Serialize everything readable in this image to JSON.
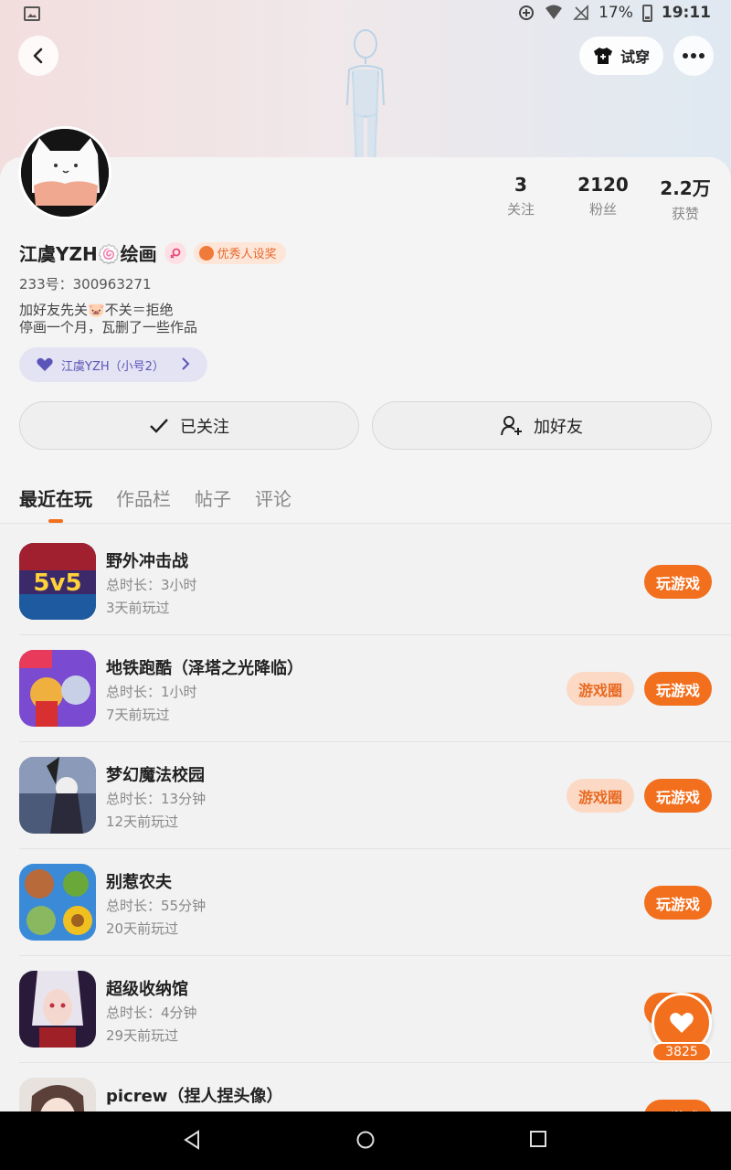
{
  "status_bar": {
    "battery": "17%",
    "time": "19:11"
  },
  "header": {
    "tryon_label": "试穿"
  },
  "profile": {
    "stats": [
      {
        "value": "3",
        "label": "关注"
      },
      {
        "value": "2120",
        "label": "粉丝"
      },
      {
        "value": "2.2万",
        "label": "获赞"
      }
    ],
    "name": "江虞YZH🍥绘画",
    "badge": "优秀人设奖",
    "uid": "233号：300963271",
    "bio_line1": "加好友先关🐷不关＝拒绝",
    "bio_line2": "停画一个月，瓦删了一些作品",
    "alt_account": "江虞YZH（小号2）",
    "follow_label": "已关注",
    "add_friend_label": "加好友"
  },
  "tabs": [
    "最近在玩",
    "作品栏",
    "帖子",
    "评论"
  ],
  "games": [
    {
      "title": "野外冲击战",
      "duration": "总时长：3小时",
      "last_played": "3天前玩过",
      "circle": false
    },
    {
      "title": "地铁跑酷（泽塔之光降临）",
      "duration": "总时长：1小时",
      "last_played": "7天前玩过",
      "circle": true
    },
    {
      "title": "梦幻魔法校园",
      "duration": "总时长：13分钟",
      "last_played": "12天前玩过",
      "circle": true
    },
    {
      "title": "别惹农夫",
      "duration": "总时长：55分钟",
      "last_played": "20天前玩过",
      "circle": false
    },
    {
      "title": "超级收纳馆",
      "duration": "总时长：4分钟",
      "last_played": "29天前玩过",
      "circle": false
    },
    {
      "title": "picrew（捏人捏头像）",
      "duration": "",
      "last_played": "",
      "circle": false
    }
  ],
  "buttons": {
    "play": "玩游戏",
    "circle": "游戏圈"
  },
  "likes": "3825",
  "colors": {
    "accent": "#f26f1d",
    "circle_bg": "#fbd9c4"
  }
}
